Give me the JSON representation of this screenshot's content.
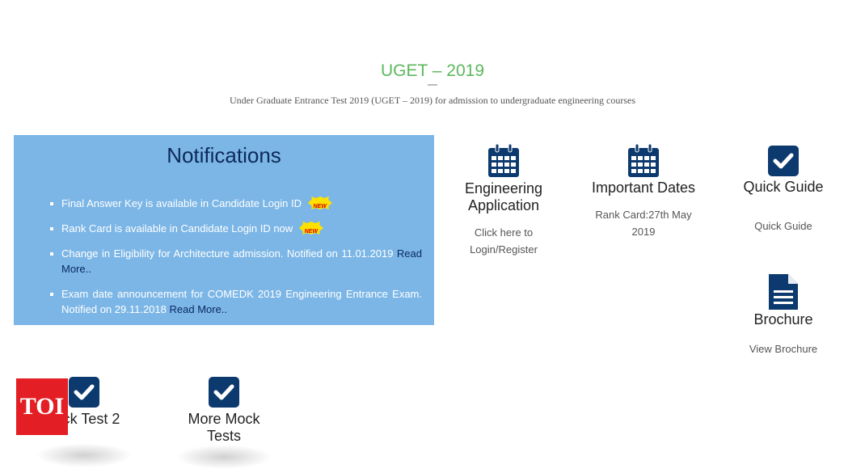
{
  "header": {
    "title": "UGET – 2019",
    "subtitle": "Under Graduate Entrance Test 2019 (UGET – 2019) for admission to undergraduate engineering courses"
  },
  "notifications": {
    "heading": "Notifications",
    "items": [
      {
        "text": "Final Answer Key is available in Candidate Login ID",
        "badge": "NEW",
        "link": ""
      },
      {
        "text": "Rank Card is available in Candidate Login ID now",
        "badge": "NEW",
        "link": ""
      },
      {
        "text": "Change in Eligibility for Architecture admission. Notified on 11.01.2019",
        "badge": "",
        "link": "Read More.."
      },
      {
        "text": "Exam date announcement for COMEDK 2019 Engineering Entrance Exam. Notified on 29.11.2018",
        "badge": "",
        "link": "Read More.."
      }
    ]
  },
  "tiles": {
    "engineering": {
      "title": "Engineering Application",
      "sub": "Click here to Login/Register",
      "icon": "calendar-icon"
    },
    "dates": {
      "title": "Important Dates",
      "sub": "Rank Card:27th May 2019",
      "icon": "calendar-icon"
    },
    "guide": {
      "title": "Quick Guide",
      "sub": "Quick Guide",
      "icon": "checkbox-icon"
    },
    "brochure": {
      "title": "Brochure",
      "sub": "View Brochure",
      "icon": "document-icon"
    },
    "mock2": {
      "title": "ck Test 2",
      "icon": "checkbox-icon"
    },
    "moremock": {
      "title": "More Mock Tests",
      "icon": "checkbox-icon"
    }
  },
  "watermark": {
    "text": "TOI"
  },
  "colors": {
    "accent_green": "#5cb85c",
    "panel_blue": "#7cb6e6",
    "icon_navy": "#0d3a6e",
    "toi_red": "#e31e24"
  }
}
